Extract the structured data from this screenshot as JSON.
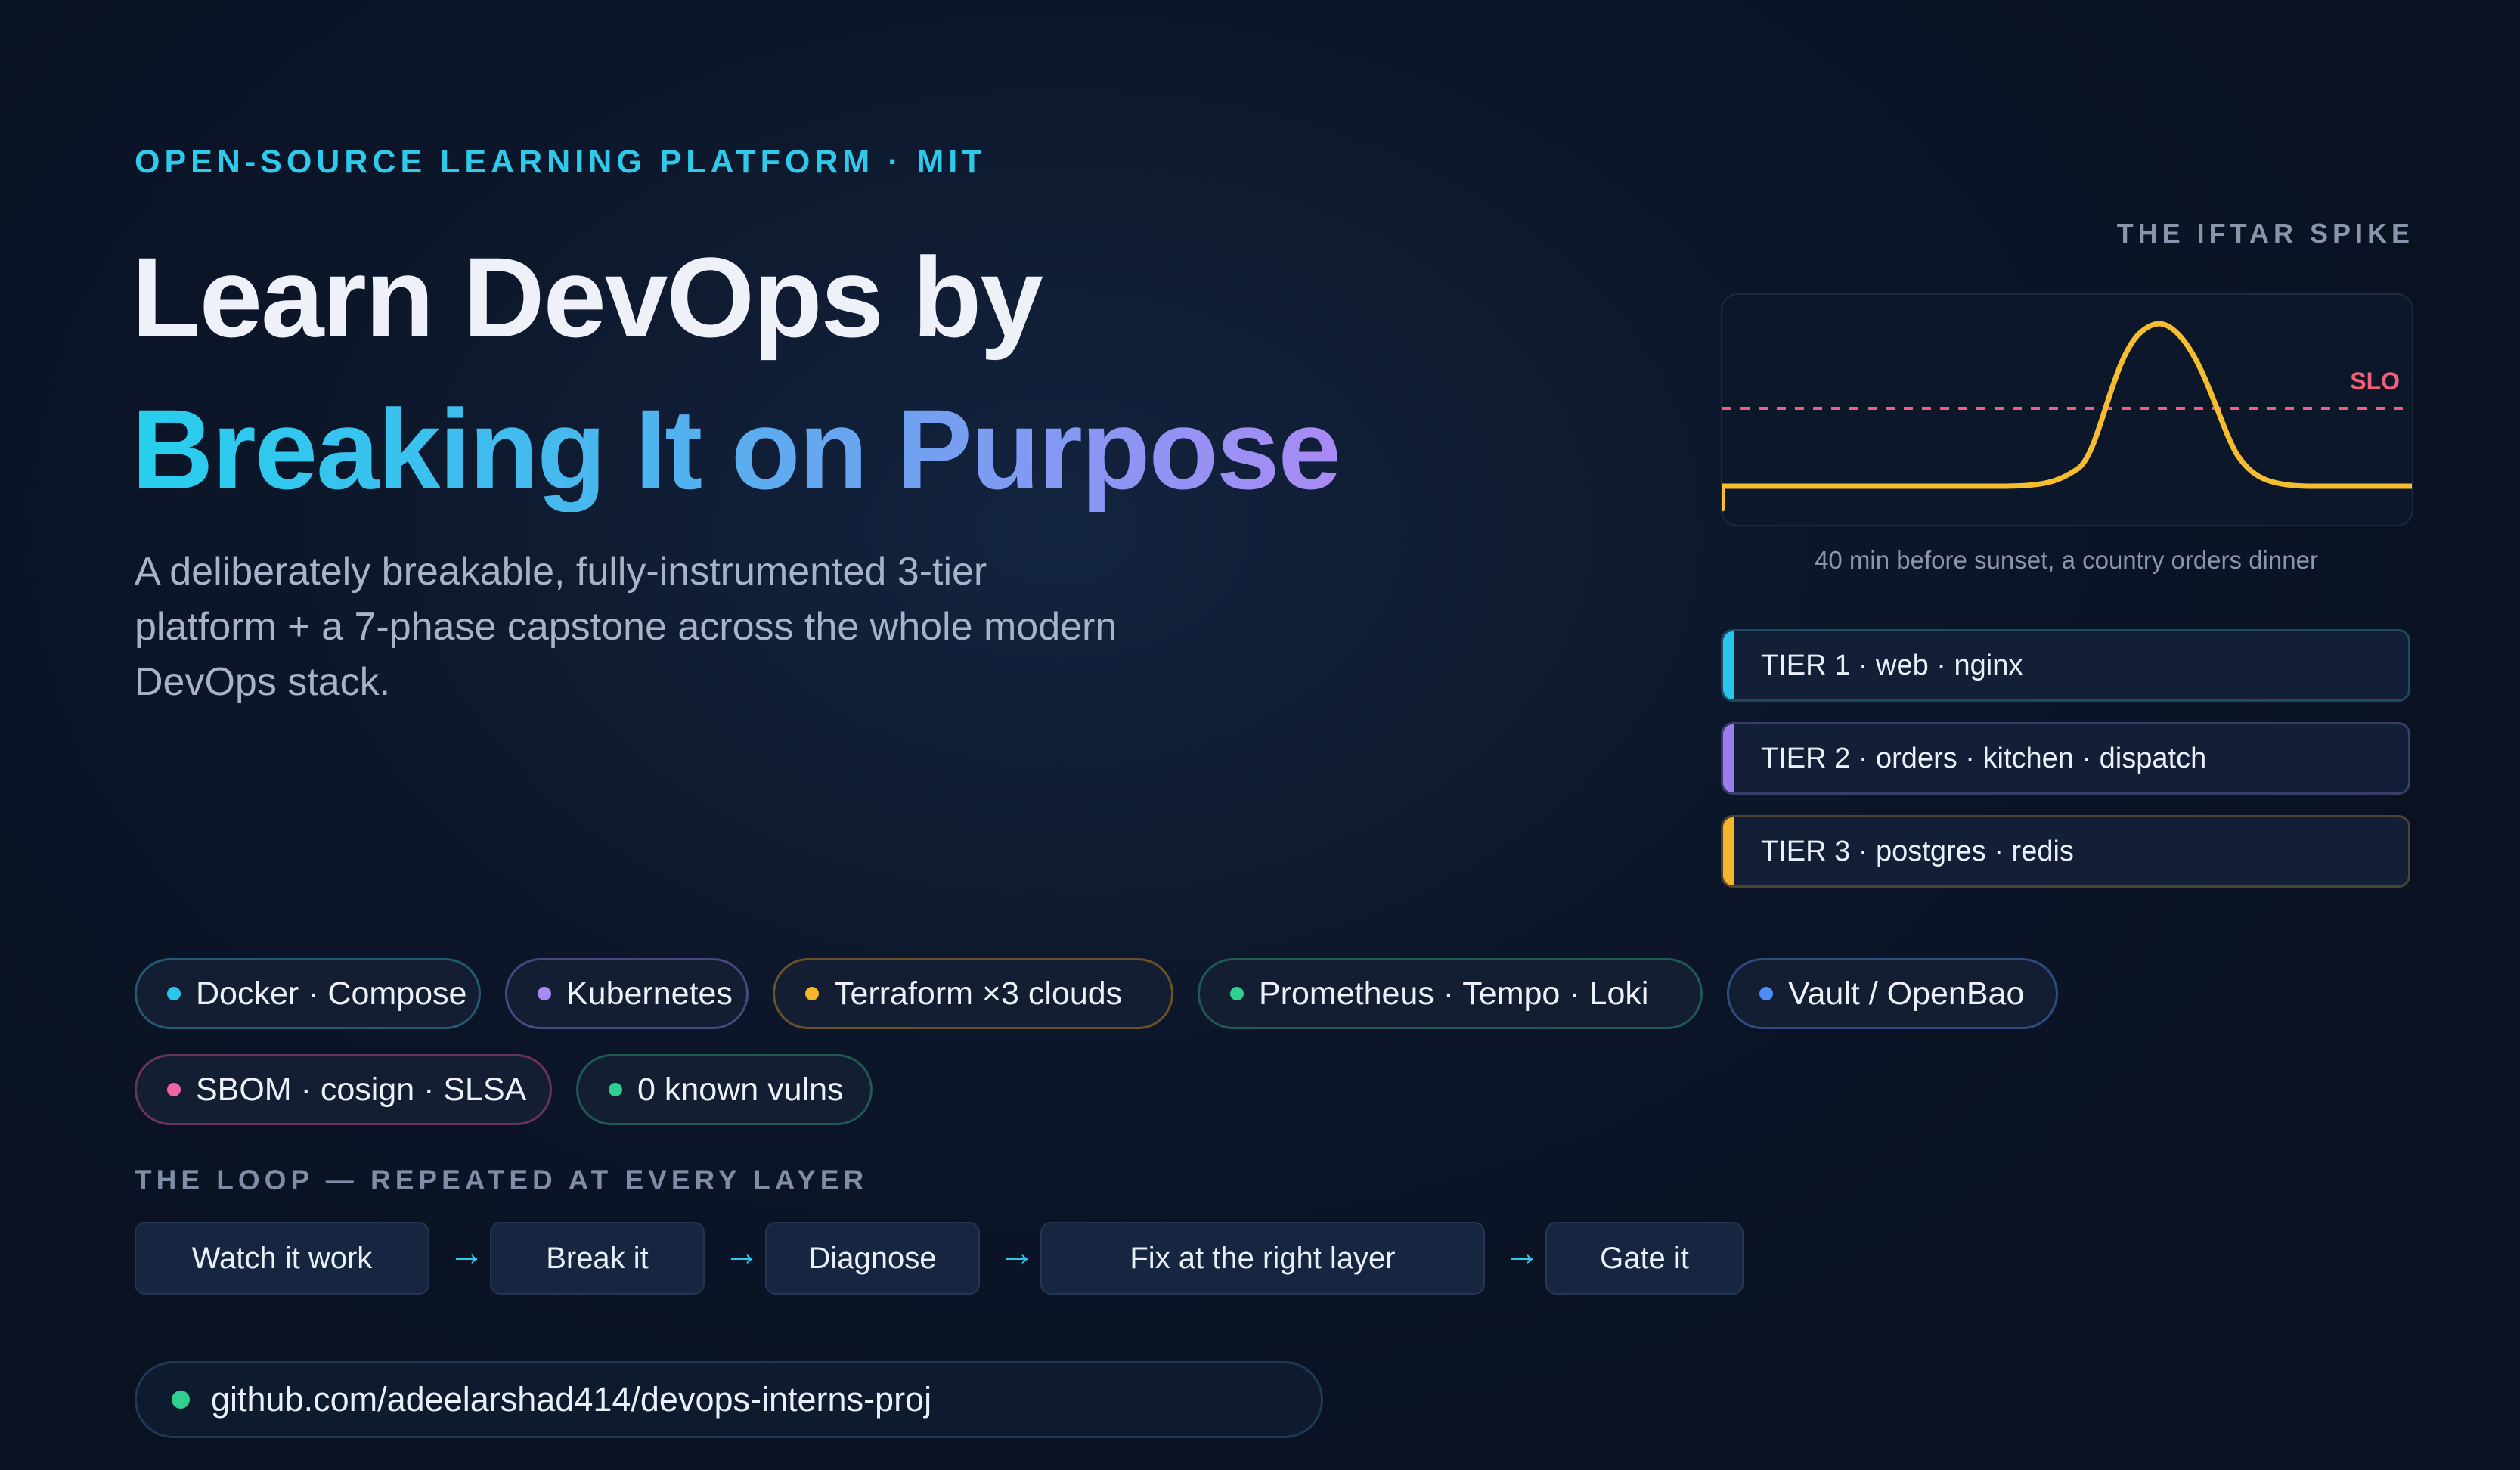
{
  "eyebrow": "OPEN-SOURCE LEARNING PLATFORM · MIT",
  "headline": {
    "line1": "Learn DevOps by",
    "line2": "Breaking It on Purpose",
    "gradient_colors": [
      "#27cfee",
      "#a98af5"
    ]
  },
  "subtitle": "A deliberately breakable, fully-instrumented 3-tier platform + a 7-phase capstone across the whole modern DevOps stack.",
  "spike_panel": {
    "label": "THE IFTAR SPIKE",
    "slo_label": "SLO",
    "caption": "40 min before sunset, a country orders dinner",
    "line_color": "#f6bd2f",
    "slo_color": "#f0607a"
  },
  "tiers": [
    {
      "label": "TIER 1 · web · nginx",
      "accent": "#27c6ea",
      "border": "#1d4a5e"
    },
    {
      "label": "TIER 2 · orders · kitchen · dispatch",
      "accent": "#9a7ef0",
      "border": "#3a3e66"
    },
    {
      "label": "TIER 3 · postgres · redis",
      "accent": "#f4b52a",
      "border": "#4a4430"
    }
  ],
  "chips": [
    {
      "label": "Docker · Compose",
      "dot": "#27c6ea",
      "border": "#235a72"
    },
    {
      "label": "Kubernetes",
      "dot": "#a98af5",
      "border": "#4a4680"
    },
    {
      "label": "Terraform ×3 clouds",
      "dot": "#f4b52a",
      "border": "#6a5228"
    },
    {
      "label": "Prometheus · Tempo · Loki",
      "dot": "#2fcf8f",
      "border": "#1f5a52"
    },
    {
      "label": "Vault / OpenBao",
      "dot": "#4d8ef5",
      "border": "#2e4c80"
    },
    {
      "label": "SBOM · cosign · SLSA",
      "dot": "#f064a6",
      "border": "#6a3458"
    },
    {
      "label": "0 known vulns",
      "dot": "#2fcf8f",
      "border": "#1f5a52"
    }
  ],
  "loop": {
    "label": "THE LOOP — REPEATED AT EVERY LAYER",
    "arrow": "→",
    "steps": [
      "Watch it work",
      "Break it",
      "Diagnose",
      "Fix at the right layer",
      "Gate it"
    ]
  },
  "repo": {
    "url": "github.com/adeelarshad414/devops-interns-proj",
    "dot": "#2fcf8f"
  }
}
